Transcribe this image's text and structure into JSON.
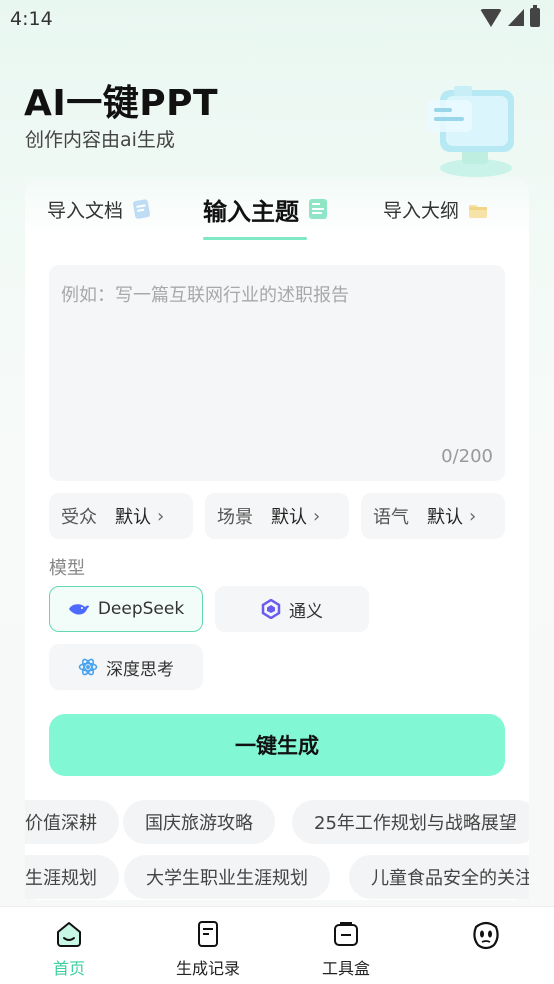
{
  "status_bar": {
    "time": "4:14"
  },
  "header": {
    "title": "AI一键PPT",
    "subtitle": "创作内容由ai生成"
  },
  "tabs": [
    {
      "label": "导入文档",
      "icon": "document-icon"
    },
    {
      "label": "输入主题",
      "icon": "topic-card-icon",
      "active": true
    },
    {
      "label": "导入大纲",
      "icon": "folder-icon"
    }
  ],
  "topic_input": {
    "placeholder": "例如：写一篇互联网行业的述职报告",
    "counter": "0/200"
  },
  "options": [
    {
      "label": "受众",
      "value": "默认"
    },
    {
      "label": "场景",
      "value": "默认"
    },
    {
      "label": "语气",
      "value": "默认"
    }
  ],
  "model_section": {
    "label": "模型",
    "models": [
      {
        "label": "DeepSeek",
        "icon": "deepseek-whale-icon",
        "selected": true
      },
      {
        "label": "通义",
        "icon": "tongyi-icon"
      },
      {
        "label": "深度思考",
        "icon": "atom-icon"
      }
    ]
  },
  "generate_button": {
    "label": "一键生成"
  },
  "suggestions": {
    "row1": [
      "价值深耕",
      "国庆旅游攻略",
      "25年工作规划与战略展望"
    ],
    "row2": [
      "生涯规划",
      "大学生职业生涯规划",
      "儿童食品安全的关注"
    ]
  },
  "bottom_nav": [
    {
      "label": "首页",
      "icon": "home-icon",
      "active": true
    },
    {
      "label": "生成记录",
      "icon": "records-icon"
    },
    {
      "label": "工具盒",
      "icon": "toolbox-icon"
    },
    {
      "label": "",
      "icon": "profile-face-icon"
    }
  ],
  "colors": {
    "accent": "#82f7d4",
    "accent_text": "#3ecfa0",
    "selected_border": "#63d7b1"
  }
}
